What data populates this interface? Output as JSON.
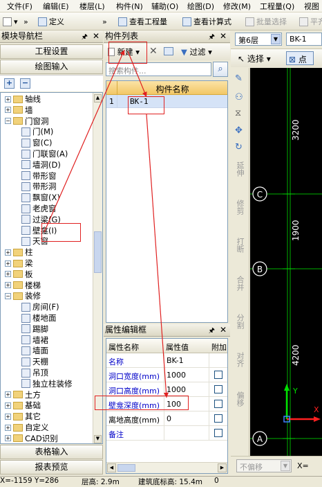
{
  "menu": [
    "文件(F)",
    "编辑(E)",
    "楼层(L)",
    "构件(N)",
    "辅助(O)",
    "绘图(D)",
    "修改(M)",
    "工程量(Q)",
    "视图"
  ],
  "toolbar": {
    "define": "定义",
    "view_qty": "查看工程量",
    "view_formula": "查看计算式",
    "batch_select": "批量选择",
    "flat": "平齐"
  },
  "floor_select": "第6层",
  "comp_select": "BK-1",
  "module_nav": {
    "title": "模块导航栏",
    "btn_project": "工程设置",
    "btn_draw": "绘图输入",
    "tree": [
      {
        "label": "轴线",
        "level": 0,
        "expander": "+"
      },
      {
        "label": "墙",
        "level": 0,
        "expander": "+"
      },
      {
        "label": "门窗洞",
        "level": 0,
        "expander": "-"
      },
      {
        "label": "门(M)",
        "level": 1
      },
      {
        "label": "窗(C)",
        "level": 1
      },
      {
        "label": "门联窗(A)",
        "level": 1
      },
      {
        "label": "墙洞(D)",
        "level": 1
      },
      {
        "label": "带形窗",
        "level": 1
      },
      {
        "label": "带形洞",
        "level": 1
      },
      {
        "label": "飘窗(X)",
        "level": 1
      },
      {
        "label": "老虎窗",
        "level": 1
      },
      {
        "label": "过梁(G)",
        "level": 1
      },
      {
        "label": "壁龛(I)",
        "level": 1
      },
      {
        "label": "天窗",
        "level": 1
      },
      {
        "label": "柱",
        "level": 0,
        "expander": "+"
      },
      {
        "label": "梁",
        "level": 0,
        "expander": "+"
      },
      {
        "label": "板",
        "level": 0,
        "expander": "+"
      },
      {
        "label": "楼梯",
        "level": 0,
        "expander": "+"
      },
      {
        "label": "装修",
        "level": 0,
        "expander": "-"
      },
      {
        "label": "房间(F)",
        "level": 1
      },
      {
        "label": "楼地面",
        "level": 1
      },
      {
        "label": "踢脚",
        "level": 1
      },
      {
        "label": "墙裙",
        "level": 1
      },
      {
        "label": "墙面",
        "level": 1
      },
      {
        "label": "天棚",
        "level": 1
      },
      {
        "label": "吊顶",
        "level": 1
      },
      {
        "label": "独立柱装修",
        "level": 1
      },
      {
        "label": "土方",
        "level": 0,
        "expander": "+"
      },
      {
        "label": "基础",
        "level": 0,
        "expander": "+"
      },
      {
        "label": "其它",
        "level": 0,
        "expander": "+"
      },
      {
        "label": "自定义",
        "level": 0,
        "expander": "+"
      },
      {
        "label": "CAD识别",
        "level": 0,
        "expander": "+"
      }
    ],
    "btn_table": "表格输入",
    "btn_report": "报表预览"
  },
  "comp_list": {
    "title": "构件列表",
    "new": "新建",
    "filter": "过滤",
    "search_placeholder": "搜索构件...",
    "col_name": "构件名称",
    "rows": [
      {
        "num": "1",
        "name": "BK-1"
      }
    ]
  },
  "prop": {
    "title": "属性编辑框",
    "col_name": "属性名称",
    "col_value": "属性值",
    "col_add": "附加",
    "rows": [
      {
        "name": "名称",
        "value": "BK-1",
        "blue": true,
        "check": false
      },
      {
        "name": "洞口宽度(mm)",
        "value": "1000",
        "blue": true,
        "check": true
      },
      {
        "name": "洞口高度(mm)",
        "value": "1000",
        "blue": true,
        "check": true
      },
      {
        "name": "壁龛深度(mm)",
        "value": "100",
        "blue": true,
        "check": true
      },
      {
        "name": "离地高度(mm)",
        "value": "0",
        "blue": false,
        "check": true
      },
      {
        "name": "备注",
        "value": "",
        "blue": true,
        "check": true
      }
    ]
  },
  "right_toolbar": {
    "select": "选择",
    "point": "点"
  },
  "side_tools": [
    "延伸",
    "修剪",
    "打断",
    "合并",
    "分割",
    "对齐",
    "偏移"
  ],
  "cad": {
    "dims": [
      "3200",
      "1900",
      "4200"
    ],
    "axes": [
      "C",
      "B",
      "A"
    ],
    "y_label": "Y",
    "x_label": "X"
  },
  "bottom_right": {
    "offset_select": "不偏移",
    "x_label": "X="
  },
  "status": {
    "coords": "X=-1159 Y=286",
    "floor_height": "层高: 2.9m",
    "base_elev": "建筑底标高: 15.4m",
    "zero": "0"
  }
}
